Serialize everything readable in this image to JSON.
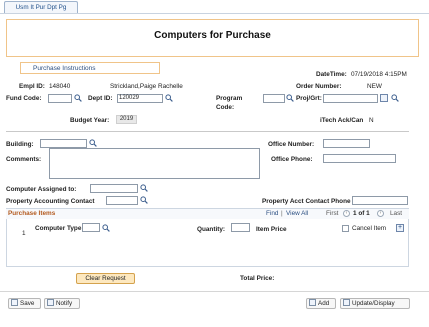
{
  "tab": {
    "label": "Usm It Pur Dpt Pg"
  },
  "page": {
    "title": "Computers for Purchase",
    "instructions_link": "Purchase Instructions"
  },
  "header": {
    "datetime_label": "DateTime:",
    "datetime_value": "07/19/2018  4:15PM",
    "empl_id_label": "Empl ID:",
    "empl_id_value": "148040",
    "empl_name": "Strickland,Paige Rachelle",
    "order_number_label": "Order Number:",
    "order_number_value": "NEW",
    "fund_code_label": "Fund Code:",
    "fund_code_value": "",
    "dept_id_label": "Dept ID:",
    "dept_id_value": "120029",
    "program_code_label_1": "Program",
    "program_code_label_2": "Code:",
    "program_code_value": "",
    "proj_grt_label": "Proj/Grt:",
    "proj_grt_value": "",
    "budget_year_label": "Budget Year:",
    "budget_year_value": "2019",
    "itech_label": "iTech Ack/Can",
    "itech_value": "N"
  },
  "location": {
    "building_label": "Building:",
    "building_value": "",
    "office_number_label": "Office Number:",
    "office_number_value": "",
    "comments_label": "Comments:",
    "comments_value": "",
    "office_phone_label": "Office Phone:",
    "office_phone_value": ""
  },
  "contacts": {
    "assigned_to_label": "Computer Assigned to:",
    "assigned_to_value": "",
    "property_contact_label": "Property Accounting Contact",
    "property_contact_value": "",
    "property_phone_label": "Property Acct Contact Phone",
    "property_phone_value": ""
  },
  "grid": {
    "title": "Purchase Items",
    "find": "Find",
    "view_all": "View All",
    "first": "First",
    "range": "1 of 1",
    "last": "Last",
    "row_number": "1",
    "computer_type_label": "Computer Type",
    "quantity_label": "Quantity:",
    "item_price_label": "Item Price",
    "cancel_item_label": "Cancel Item",
    "add_row": "+"
  },
  "footer": {
    "clear_request": "Clear Request",
    "total_price_label": "Total Price:",
    "save": "Save",
    "notify": "Notify",
    "add": "Add",
    "update_display": "Update/Display"
  }
}
